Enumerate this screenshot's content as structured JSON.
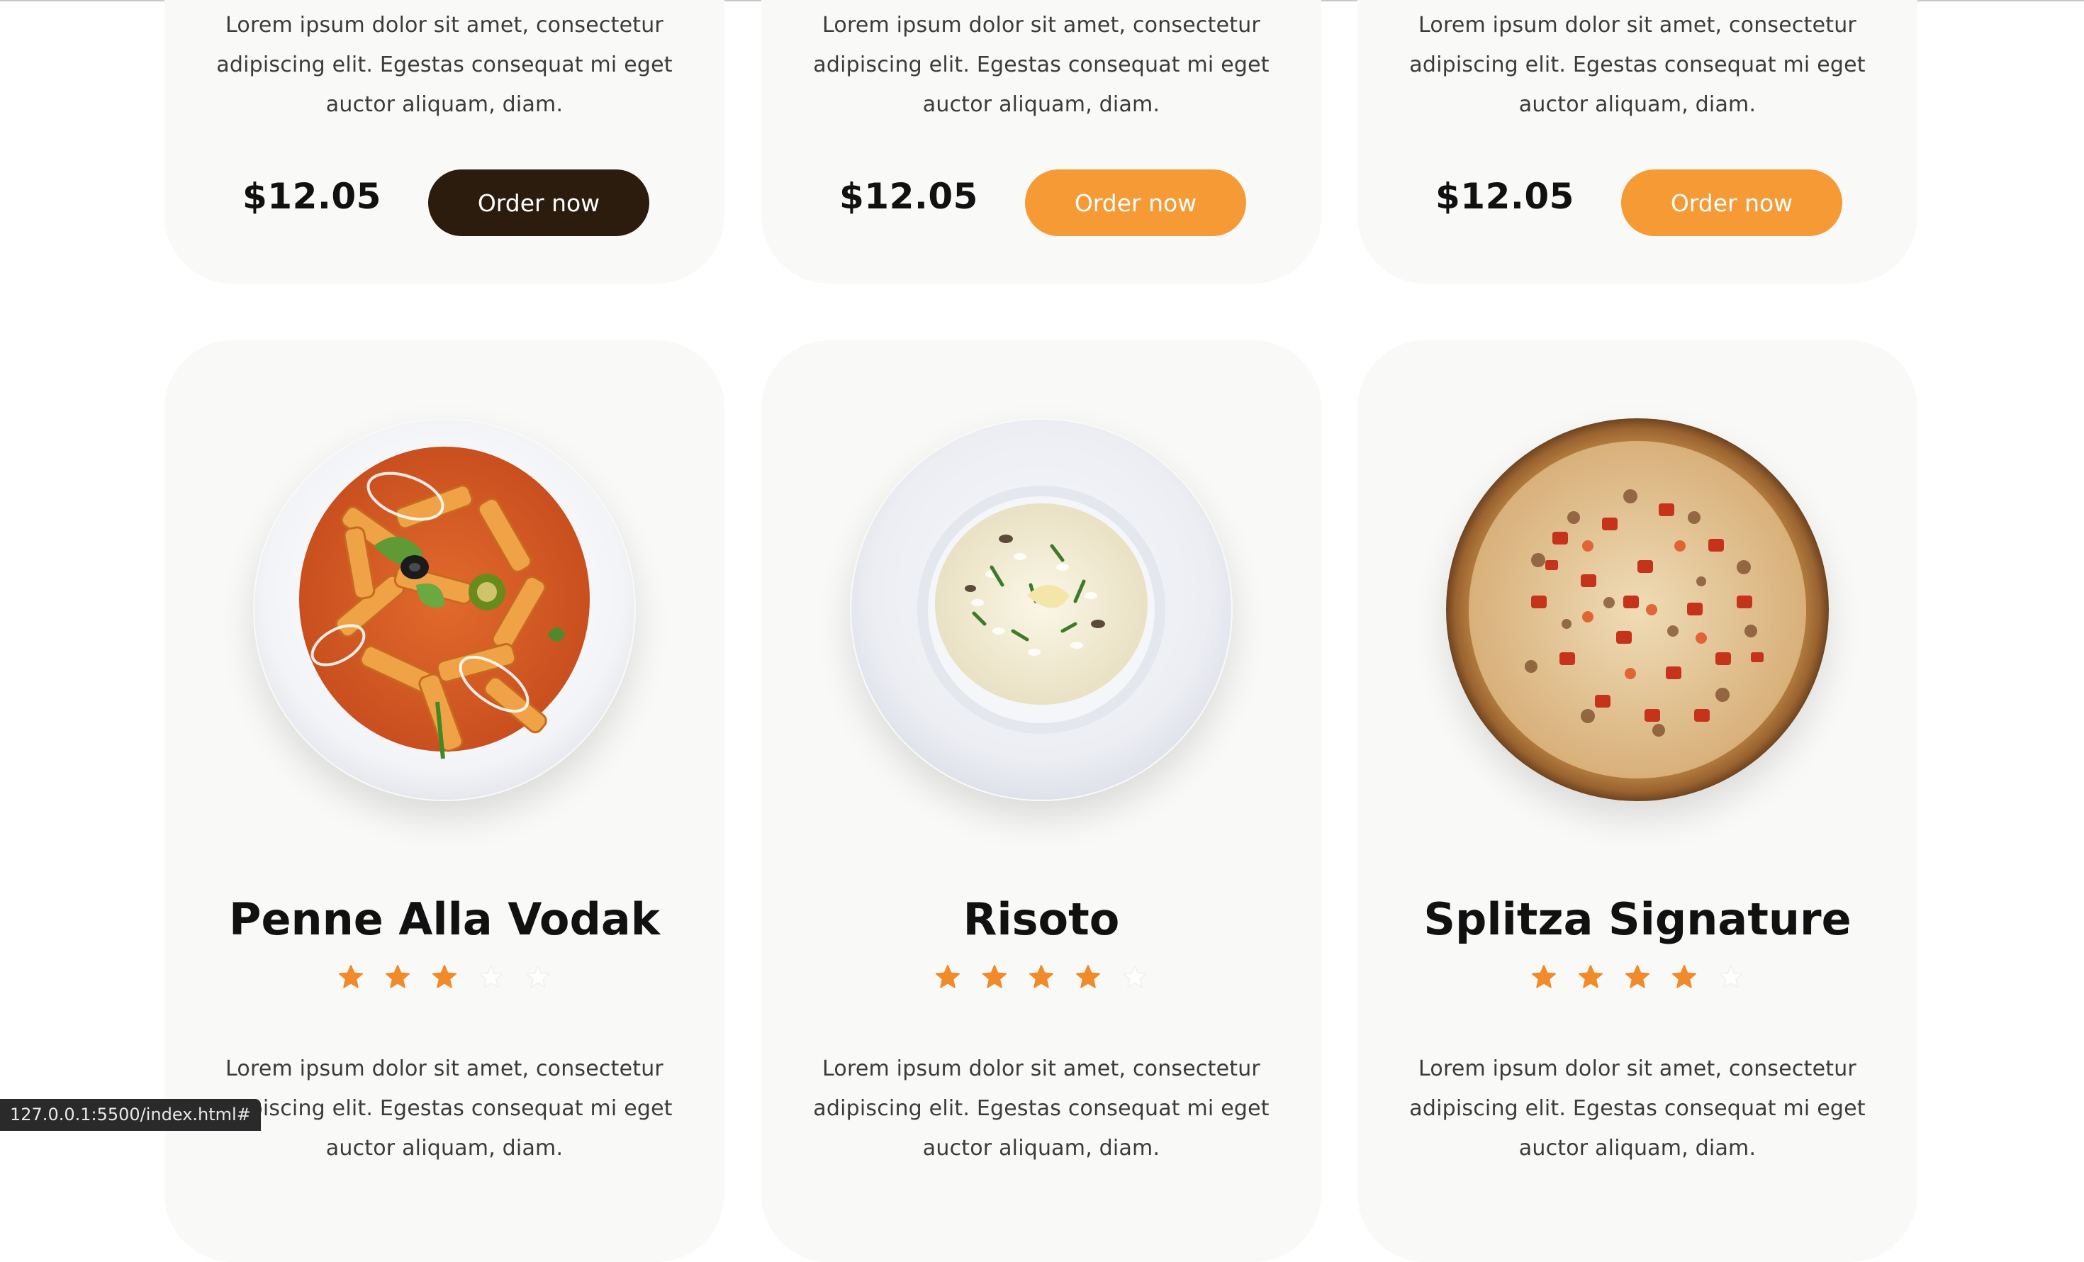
{
  "status_url": "127.0.0.1:5500/index.html#",
  "colors": {
    "accent": "#f59a34",
    "dark_button": "#2b1c0e",
    "star_filled": "#f08a2a",
    "star_empty": "#ffffff",
    "card_bg": "#f9f9f7"
  },
  "top_row": [
    {
      "description_lines": [
        "Lorem ipsum dolor sit amet, consectetur",
        "adipiscing elit. Egestas consequat mi eget",
        "auctor aliquam, diam."
      ],
      "price": "$12.05",
      "button_label": "Order now",
      "button_style": "dark"
    },
    {
      "description_lines": [
        "Lorem ipsum dolor sit amet, consectetur",
        "adipiscing elit. Egestas consequat mi eget",
        "auctor aliquam, diam."
      ],
      "price": "$12.05",
      "button_label": "Order now",
      "button_style": "orange"
    },
    {
      "description_lines": [
        "Lorem ipsum dolor sit amet, consectetur",
        "adipiscing elit. Egestas consequat mi eget",
        "auctor aliquam, diam."
      ],
      "price": "$12.05",
      "button_label": "Order now",
      "button_style": "orange"
    }
  ],
  "bottom_row": [
    {
      "name": "Penne Alla Vodak",
      "image_icon": "penne-pasta-plate-image",
      "rating": 3,
      "rating_max": 5,
      "description_lines": [
        "Lorem ipsum dolor sit amet, consectetur",
        "adipiscing elit. Egestas consequat mi eget",
        "auctor aliquam, diam."
      ]
    },
    {
      "name": "Risoto",
      "image_icon": "risotto-bowl-image",
      "rating": 4,
      "rating_max": 5,
      "description_lines": [
        "Lorem ipsum dolor sit amet, consectetur",
        "adipiscing elit. Egestas consequat mi eget",
        "auctor aliquam, diam."
      ]
    },
    {
      "name": "Splitza Signature",
      "image_icon": "pizza-image",
      "rating": 4,
      "rating_max": 5,
      "description_lines": [
        "Lorem ipsum dolor sit amet, consectetur",
        "adipiscing elit. Egestas consequat mi eget",
        "auctor aliquam, diam."
      ]
    }
  ]
}
